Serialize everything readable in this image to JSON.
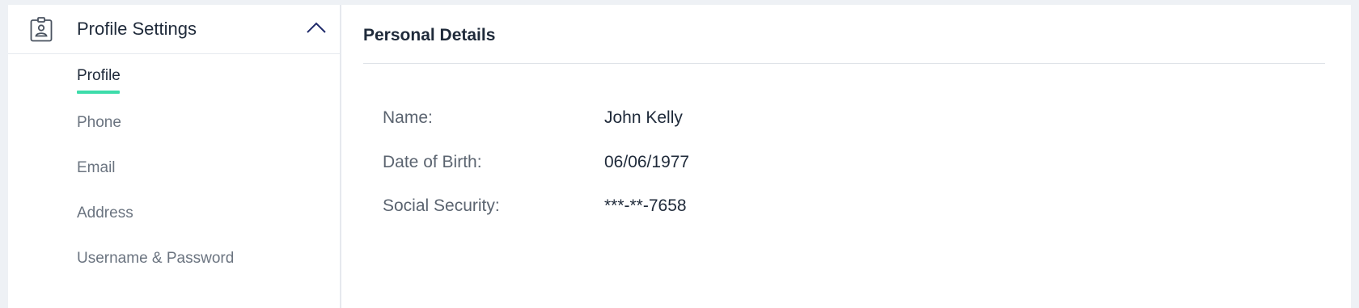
{
  "sidebar": {
    "title": "Profile Settings",
    "header_icon": "badge-icon",
    "collapse_icon": "chevron-up-icon",
    "items": [
      {
        "label": "Profile",
        "active": true
      },
      {
        "label": "Phone",
        "active": false
      },
      {
        "label": "Email",
        "active": false
      },
      {
        "label": "Address",
        "active": false
      },
      {
        "label": "Username & Password",
        "active": false
      }
    ]
  },
  "main": {
    "section_title": "Personal Details",
    "fields": [
      {
        "label": "Name:",
        "value": "John Kelly"
      },
      {
        "label": "Date of Birth:",
        "value": "06/06/1977"
      },
      {
        "label": "Social Security:",
        "value": "***-**-7658"
      }
    ]
  },
  "colors": {
    "accent": "#3ddcaa",
    "text_primary": "#1f2a3a",
    "text_secondary": "#6b7480",
    "background": "#eef1f5"
  }
}
